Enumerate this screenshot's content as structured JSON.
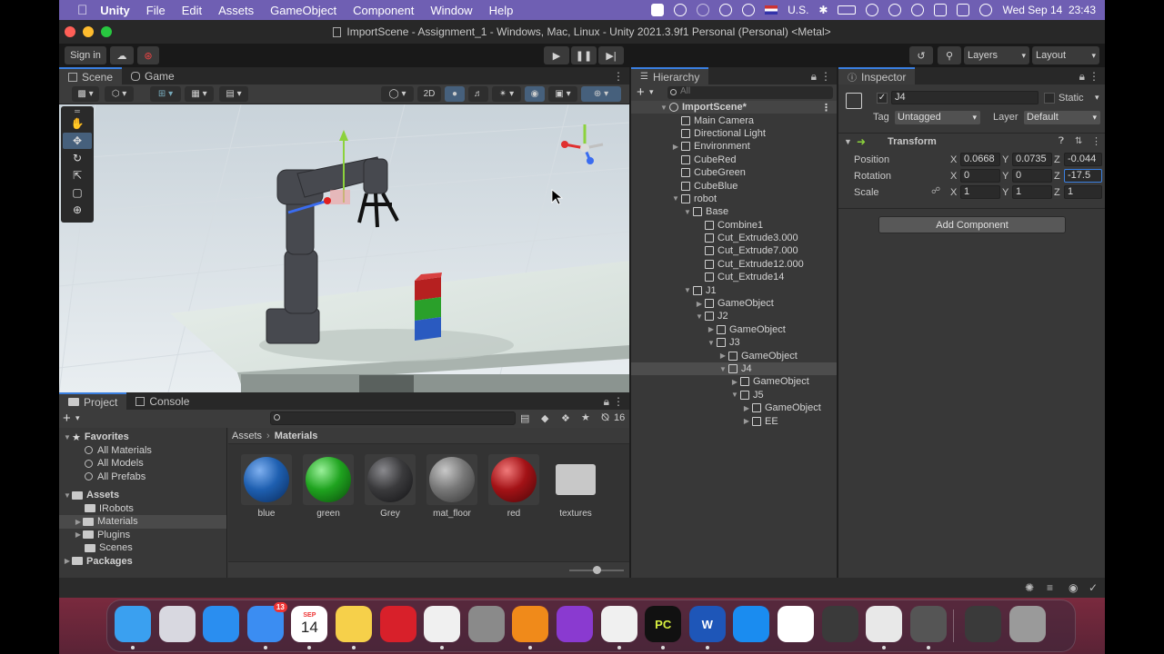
{
  "menubar": {
    "app": "Unity",
    "items": [
      "File",
      "Edit",
      "Assets",
      "GameObject",
      "Component",
      "Window",
      "Help"
    ],
    "input_source": "U.S.",
    "clock": "Wed Sep 14  23:43"
  },
  "window": {
    "title": "ImportScene - Assignment_1 - Windows, Mac, Linux - Unity 2021.3.9f1 Personal (Personal) <Metal>"
  },
  "toolbar": {
    "sign_in": "Sign in",
    "layers": "Layers",
    "layout": "Layout"
  },
  "scene": {
    "tabs": [
      "Scene",
      "Game"
    ],
    "mode_2d": "2D"
  },
  "project": {
    "tabs": [
      "Project",
      "Console"
    ],
    "hidden_count": "16",
    "tree": [
      {
        "label": "Favorites",
        "kind": "header",
        "icon": "star-icon"
      },
      {
        "label": "All Materials",
        "kind": "search"
      },
      {
        "label": "All Models",
        "kind": "search"
      },
      {
        "label": "All Prefabs",
        "kind": "search"
      },
      {
        "label": "Assets",
        "kind": "header",
        "icon": "folder-icon"
      },
      {
        "label": "IRobots",
        "kind": "folder"
      },
      {
        "label": "Materials",
        "kind": "folder",
        "selected": true
      },
      {
        "label": "Plugins",
        "kind": "folder"
      },
      {
        "label": "Scenes",
        "kind": "folder"
      },
      {
        "label": "Packages",
        "kind": "header",
        "icon": "folder-icon"
      }
    ],
    "breadcrumb": [
      "Assets",
      "Materials"
    ],
    "assets": [
      {
        "label": "blue",
        "color": "#1e5fb0"
      },
      {
        "label": "green",
        "color": "#1fa31f"
      },
      {
        "label": "Grey",
        "color": "#3a3a3c"
      },
      {
        "label": "mat_floor",
        "color": "#777777"
      },
      {
        "label": "red",
        "color": "#a31216"
      },
      {
        "label": "textures",
        "color": "folder"
      }
    ]
  },
  "hierarchy": {
    "title": "Hierarchy",
    "search_placeholder": "All",
    "rows": [
      {
        "label": "ImportScene*",
        "depth": 0,
        "expanded": true,
        "scene": true
      },
      {
        "label": "Main Camera",
        "depth": 1
      },
      {
        "label": "Directional Light",
        "depth": 1
      },
      {
        "label": "Environment",
        "depth": 1,
        "collapsed": true
      },
      {
        "label": "CubeRed",
        "depth": 1
      },
      {
        "label": "CubeGreen",
        "depth": 1
      },
      {
        "label": "CubeBlue",
        "depth": 1
      },
      {
        "label": "robot",
        "depth": 1,
        "expanded": true
      },
      {
        "label": "Base",
        "depth": 2,
        "expanded": true
      },
      {
        "label": "Combine1",
        "depth": 3
      },
      {
        "label": "Cut_Extrude3.000",
        "depth": 3
      },
      {
        "label": "Cut_Extrude7.000",
        "depth": 3
      },
      {
        "label": "Cut_Extrude12.000",
        "depth": 3
      },
      {
        "label": "Cut_Extrude14",
        "depth": 3
      },
      {
        "label": "J1",
        "depth": 2,
        "expanded": true
      },
      {
        "label": "GameObject",
        "depth": 3,
        "collapsed": true
      },
      {
        "label": "J2",
        "depth": 3,
        "expanded": true
      },
      {
        "label": "GameObject",
        "depth": 4,
        "collapsed": true
      },
      {
        "label": "J3",
        "depth": 4,
        "expanded": true
      },
      {
        "label": "GameObject",
        "depth": 5,
        "collapsed": true
      },
      {
        "label": "J4",
        "depth": 5,
        "expanded": true,
        "selected": true
      },
      {
        "label": "GameObject",
        "depth": 6,
        "collapsed": true
      },
      {
        "label": "J5",
        "depth": 6,
        "expanded": true
      },
      {
        "label": "GameObject",
        "depth": 7,
        "collapsed": true
      },
      {
        "label": "EE",
        "depth": 7,
        "collapsed": true
      }
    ]
  },
  "inspector": {
    "title": "Inspector",
    "object_name": "J4",
    "static_label": "Static",
    "tag_label": "Tag",
    "tag_value": "Untagged",
    "layer_label": "Layer",
    "layer_value": "Default",
    "transform_title": "Transform",
    "position_label": "Position",
    "rotation_label": "Rotation",
    "scale_label": "Scale",
    "axis": {
      "x": "X",
      "y": "Y",
      "z": "Z"
    },
    "position": {
      "x": "0.0668",
      "y": "0.0735",
      "z": "-0.044"
    },
    "rotation": {
      "x": "0",
      "y": "0",
      "z": "-17.5"
    },
    "scale": {
      "x": "1",
      "y": "1",
      "z": "1"
    },
    "add_component": "Add Component"
  },
  "dock": {
    "mail_badge": "13",
    "calendar_month": "SEP",
    "calendar_day": "14",
    "apps": [
      {
        "name": "finder-icon",
        "color": "#3aa0f0",
        "label": ""
      },
      {
        "name": "launchpad-icon",
        "color": "#d8d8e0",
        "label": ""
      },
      {
        "name": "safari-icon",
        "color": "#2a8ef0",
        "label": ""
      },
      {
        "name": "mail-icon",
        "color": "#3b8df2",
        "label": ""
      },
      {
        "name": "calendar-icon",
        "color": "#ffffff",
        "label": ""
      },
      {
        "name": "notes-icon",
        "color": "#f6d04a",
        "label": ""
      },
      {
        "name": "photo-booth-icon",
        "color": "#d8202a",
        "label": ""
      },
      {
        "name": "chrome-icon",
        "color": "#f0f0f0",
        "label": ""
      },
      {
        "name": "system-preferences-icon",
        "color": "#8a8a8a",
        "label": ""
      },
      {
        "name": "books-icon",
        "color": "#f08a1a",
        "label": ""
      },
      {
        "name": "github-desktop-icon",
        "color": "#8a3ad0",
        "label": ""
      },
      {
        "name": "vscode-icon",
        "color": "#f0f0f0",
        "label": ""
      },
      {
        "name": "pycharm-icon",
        "color": "#111111",
        "label": "PC"
      },
      {
        "name": "word-icon",
        "color": "#1e56b8",
        "label": "W"
      },
      {
        "name": "app-store-icon",
        "color": "#1a8cf0",
        "label": ""
      },
      {
        "name": "slack-icon",
        "color": "#ffffff",
        "label": ""
      },
      {
        "name": "phone-icon",
        "color": "#3a3a3a",
        "label": ""
      },
      {
        "name": "unity-hub-icon",
        "color": "#e8e8e8",
        "label": ""
      },
      {
        "name": "unity-editor-icon",
        "color": "#555555",
        "label": ""
      },
      {
        "name": "minimized-window-icon",
        "color": "#3a3a3a",
        "label": ""
      },
      {
        "name": "trash-icon",
        "color": "#9a9a9a",
        "label": ""
      }
    ]
  }
}
